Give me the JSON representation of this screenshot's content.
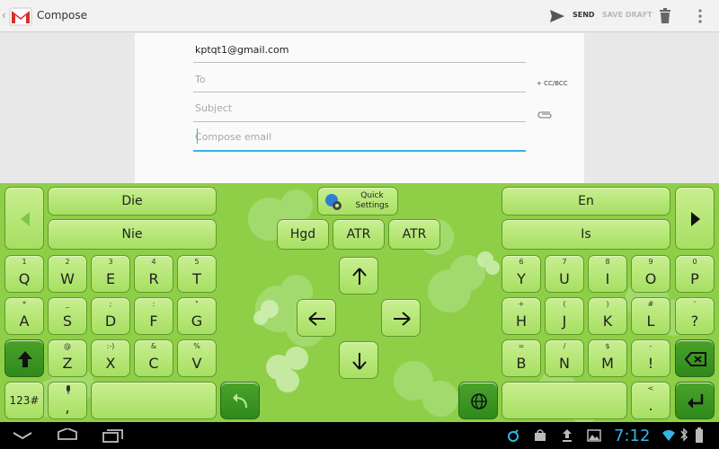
{
  "actionbar": {
    "title": "Compose",
    "send_label": "SEND",
    "save_draft_label": "SAVE DRAFT"
  },
  "compose": {
    "from": "kptqt1@gmail.com",
    "to_placeholder": "To",
    "cc_bcc_label": "+ CC/BCC",
    "subject_placeholder": "Subject",
    "body_placeholder": "Compose email"
  },
  "keyboard": {
    "suggestions_left": [
      "Die",
      "Nie"
    ],
    "suggestions_right": [
      "En",
      "Is"
    ],
    "quick_settings": "Quick Settings",
    "middle_suggestions": [
      "Hgd",
      "ATR",
      "ATR"
    ],
    "row1": [
      {
        "main": "Q",
        "sub": "1"
      },
      {
        "main": "W",
        "sub": "2"
      },
      {
        "main": "E",
        "sub": "3"
      },
      {
        "main": "R",
        "sub": "4"
      },
      {
        "main": "T",
        "sub": "5"
      },
      {
        "main": "Y",
        "sub": "6"
      },
      {
        "main": "U",
        "sub": "7"
      },
      {
        "main": "I",
        "sub": "8"
      },
      {
        "main": "O",
        "sub": "9"
      },
      {
        "main": "P",
        "sub": "0"
      }
    ],
    "row2": [
      {
        "main": "A",
        "sub": "*"
      },
      {
        "main": "S",
        "sub": "_"
      },
      {
        "main": "D",
        "sub": ";"
      },
      {
        "main": "F",
        "sub": ":"
      },
      {
        "main": "G",
        "sub": "\""
      },
      {
        "main": "H",
        "sub": "+"
      },
      {
        "main": "J",
        "sub": "("
      },
      {
        "main": "K",
        "sub": ")"
      },
      {
        "main": "L",
        "sub": "#"
      },
      {
        "main": "?",
        "sub": "'"
      }
    ],
    "row3": [
      {
        "main": "Z",
        "sub": "@"
      },
      {
        "main": "X",
        "sub": ":-)"
      },
      {
        "main": "C",
        "sub": "&"
      },
      {
        "main": "V",
        "sub": "%"
      },
      {
        "main": "B",
        "sub": "="
      },
      {
        "main": "N",
        "sub": "/"
      },
      {
        "main": "M",
        "sub": "$"
      },
      {
        "main": "!",
        "sub": "-"
      }
    ],
    "numbers_key": "123#",
    "comma_key": ",",
    "period_key": ".",
    "period_sub": "<"
  },
  "statusbar": {
    "time": "7:12"
  },
  "colors": {
    "accent": "#33b5e5",
    "keyboard_green": "#8fcf48",
    "key_face": "#b5e574"
  }
}
